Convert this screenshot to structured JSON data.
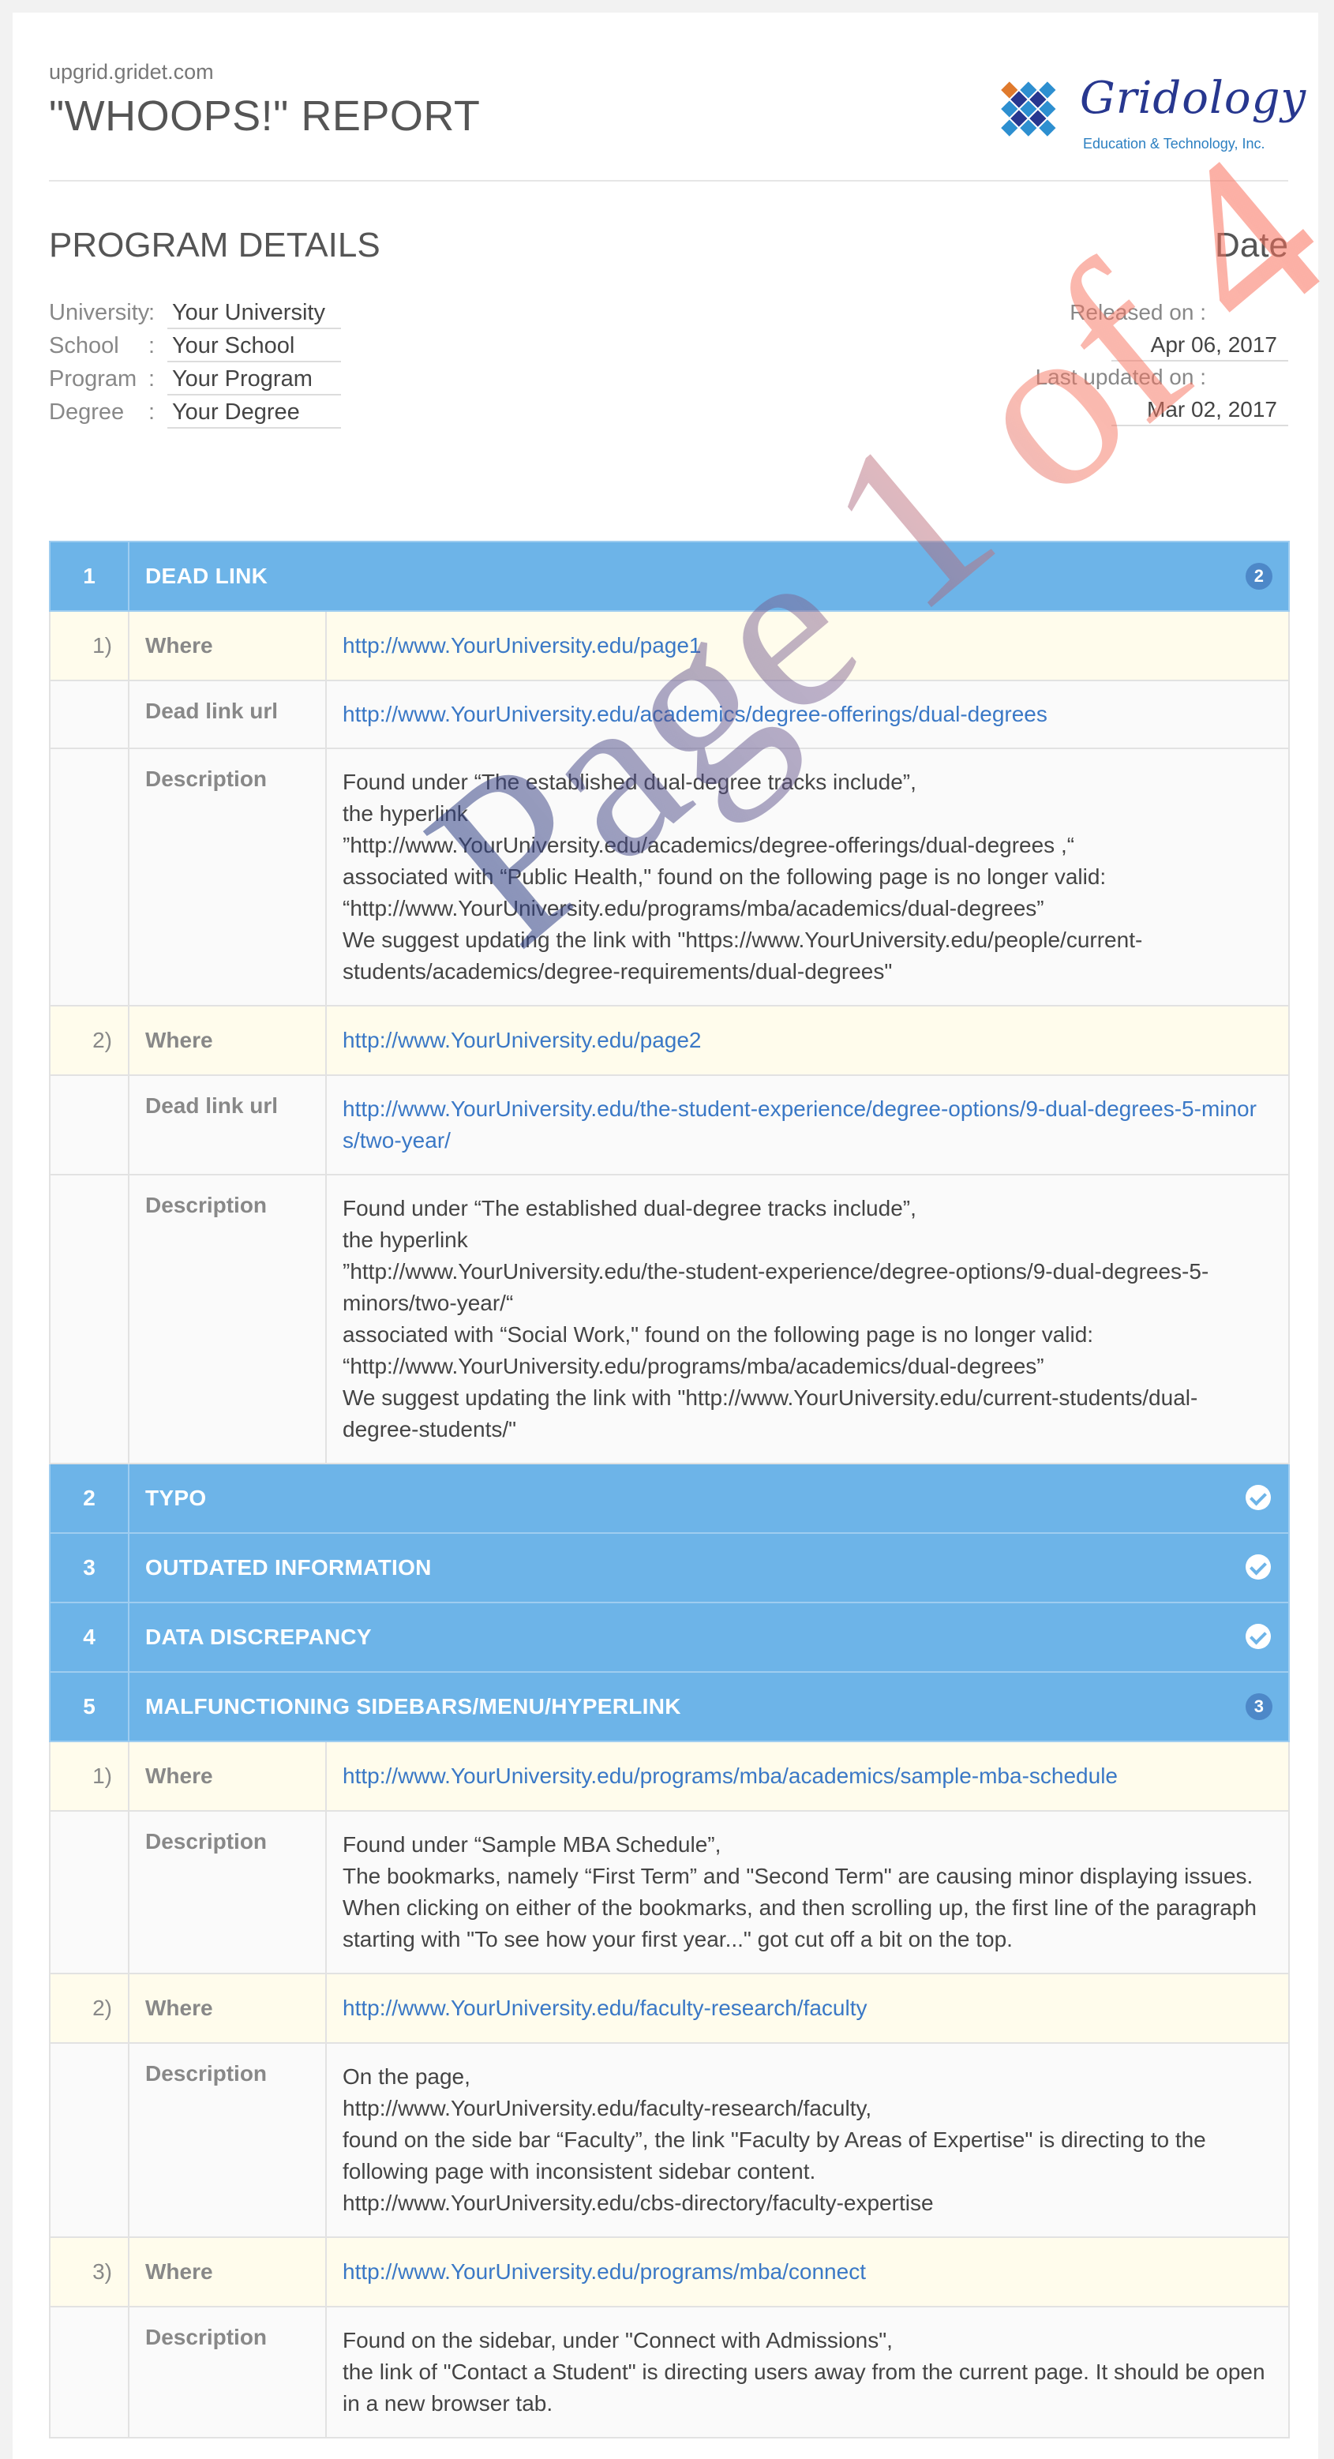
{
  "header": {
    "site": "upgrid.gridet.com",
    "title": "\"WHOOPS!\" REPORT",
    "logo_name": "Gridology",
    "logo_sub": "Education & Technology, Inc."
  },
  "program": {
    "title": "PROGRAM DETAILS",
    "fields": [
      {
        "label": "University",
        "value": "Your University"
      },
      {
        "label": "School",
        "value": "Your School"
      },
      {
        "label": "Program",
        "value": "Your Program"
      },
      {
        "label": "Degree",
        "value": "Your Degree"
      }
    ]
  },
  "dates": {
    "title": "Date",
    "released_label": "Released on :",
    "released_value": "Apr 06, 2017",
    "updated_label": "Last updated on :",
    "updated_value": "Mar 02, 2017"
  },
  "colors": {
    "category_bar": "#6db4e8",
    "where_row": "#fffcec",
    "link": "#3a78c6",
    "badge": "#4d88c8"
  },
  "watermark": "Page 1 of 4",
  "categories": [
    {
      "num": "1",
      "title": "DEAD LINK",
      "badge": "2",
      "items": [
        {
          "idx": "1)",
          "where_label": "Where",
          "where": "http://www.YourUniversity.edu/page1",
          "deadlink_label": "Dead link url",
          "deadlink": "http://www.YourUniversity.edu/academics/degree-offerings/dual-degrees",
          "desc_label": "Description",
          "desc": [
            "Found under “The established dual-degree tracks include”,",
            "the hyperlink",
            "”http://www.YourUniversity.edu/academics/degree-offerings/dual-degrees ,“",
            "associated with “Public Health,\" found on the following page is no longer valid:",
            "“http://www.YourUniversity.edu/programs/mba/academics/dual-degrees”",
            "We suggest updating the link with \"https://www.YourUniversity.edu/people/current-students/academics/degree-requirements/dual-degrees\""
          ]
        },
        {
          "idx": "2)",
          "where_label": "Where",
          "where": "http://www.YourUniversity.edu/page2",
          "deadlink_label": "Dead link url",
          "deadlink": "http://www.YourUniversity.edu/the-student-experience/degree-options/9-dual-degrees-5-minors/two-year/",
          "desc_label": "Description",
          "desc": [
            "Found under “The established dual-degree tracks include”,",
            "the hyperlink",
            "”http://www.YourUniversity.edu/the-student-experience/degree-options/9-dual-degrees-5-minors/two-year/“",
            "associated with “Social Work,\" found on the following page is no longer valid:",
            "“http://www.YourUniversity.edu/programs/mba/academics/dual-degrees”",
            "We suggest updating the link with \"http://www.YourUniversity.edu/current-students/dual-degree-students/\""
          ]
        }
      ]
    },
    {
      "num": "2",
      "title": "TYPO"
    },
    {
      "num": "3",
      "title": "OUTDATED INFORMATION"
    },
    {
      "num": "4",
      "title": "DATA DISCREPANCY"
    },
    {
      "num": "5",
      "title": "MALFUNCTIONING SIDEBARS/MENU/HYPERLINK",
      "badge": "3",
      "items": [
        {
          "idx": "1)",
          "where_label": "Where",
          "where": "http://www.YourUniversity.edu/programs/mba/academics/sample-mba-schedule",
          "desc_label": "Description",
          "desc": [
            "Found under “Sample MBA Schedule”,",
            "The bookmarks, namely “First Term” and \"Second Term\" are causing minor displaying issues. When clicking on either of the bookmarks, and then scrolling up, the first line of the paragraph starting with \"To see how your first year...\" got cut off a bit on the top."
          ]
        },
        {
          "idx": "2)",
          "where_label": "Where",
          "where": "http://www.YourUniversity.edu/faculty-research/faculty",
          "desc_label": "Description",
          "desc": [
            "On the page,",
            "http://www.YourUniversity.edu/faculty-research/faculty,",
            "found on the side bar “Faculty”, the link \"Faculty by Areas of Expertise\" is directing to the following page with inconsistent sidebar content.",
            "http://www.YourUniversity.edu/cbs-directory/faculty-expertise"
          ]
        },
        {
          "idx": "3)",
          "where_label": "Where",
          "where": "http://www.YourUniversity.edu/programs/mba/connect",
          "desc_label": "Description",
          "desc": [
            "Found on the sidebar, under \"Connect with Admissions\",",
            "the link of \"Contact a Student\" is directing users away from the current page. It should be open in a new browser tab."
          ]
        }
      ]
    }
  ]
}
